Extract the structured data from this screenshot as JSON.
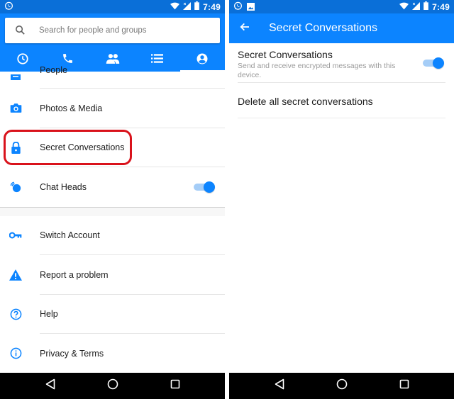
{
  "left": {
    "status_bar": {
      "time": "7:49",
      "left_icons": [
        "whatsapp-icon"
      ],
      "right_icons": [
        "wifi-icon",
        "signal-icon",
        "battery-icon"
      ]
    },
    "search": {
      "placeholder": "Search for people and groups",
      "value": ""
    },
    "tabs": [
      {
        "icon": "clock-icon",
        "name": "recent",
        "active": false
      },
      {
        "icon": "phone-icon",
        "name": "calls",
        "active": false
      },
      {
        "icon": "people-icon",
        "name": "groups",
        "active": false
      },
      {
        "icon": "list-icon",
        "name": "list",
        "active": false
      },
      {
        "icon": "account-icon",
        "name": "profile",
        "active": true
      }
    ],
    "list": {
      "people": {
        "label": "People",
        "icon": "people-book-icon"
      },
      "photos": {
        "label": "Photos & Media",
        "icon": "camera-icon"
      },
      "secret": {
        "label": "Secret Conversations",
        "icon": "lock-icon",
        "highlighted": true
      },
      "chat_heads": {
        "label": "Chat Heads",
        "icon": "chat-heads-icon",
        "toggle_on": true
      },
      "switch_account": {
        "label": "Switch Account",
        "icon": "key-icon"
      },
      "report": {
        "label": "Report a problem",
        "icon": "warning-icon"
      },
      "help": {
        "label": "Help",
        "icon": "help-icon"
      },
      "privacy": {
        "label": "Privacy & Terms",
        "icon": "info-icon"
      }
    }
  },
  "right": {
    "status_bar": {
      "time": "7:49",
      "left_icons": [
        "whatsapp-icon",
        "image-icon"
      ],
      "right_icons": [
        "wifi-icon",
        "signal-icon",
        "battery-icon"
      ]
    },
    "app_bar": {
      "title": "Secret Conversations"
    },
    "settings": {
      "secret_toggle": {
        "title": "Secret Conversations",
        "description": "Send and receive encrypted messages with this device.",
        "toggle_on": true
      },
      "delete_all": {
        "title": "Delete all secret conversations"
      }
    }
  },
  "navbar": {
    "buttons": [
      "back",
      "home",
      "recents"
    ]
  },
  "colors": {
    "primary": "#0c84ff",
    "status_bar": "#0a6fd8",
    "highlight": "#d9121b",
    "toggle_track": "#a5cdf7"
  }
}
